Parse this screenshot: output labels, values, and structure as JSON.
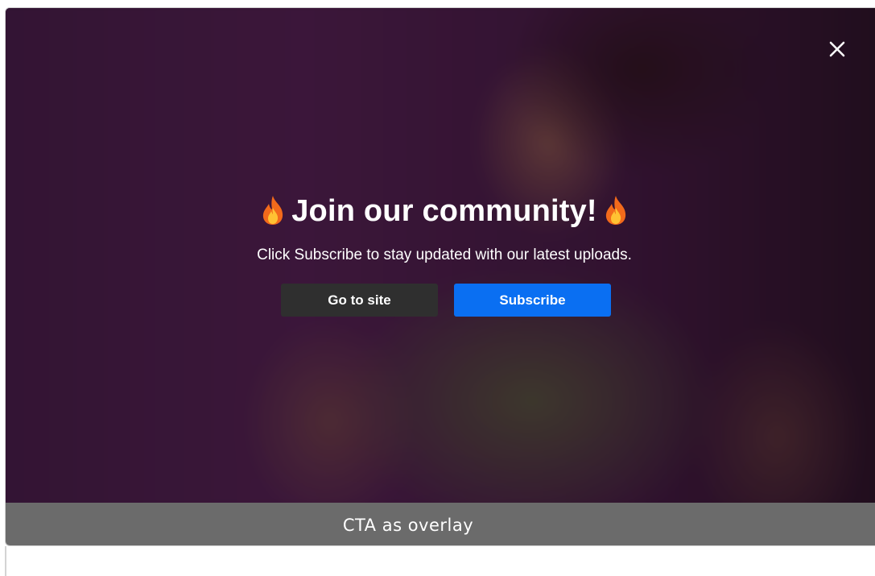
{
  "overlay": {
    "title": "Join our community!",
    "title_emoji": "🔥",
    "subtitle": "Click Subscribe to stay updated with our latest uploads.",
    "secondary_button_label": "Go to site",
    "primary_button_label": "Subscribe",
    "close_icon": "close-icon",
    "colors": {
      "primary_button": "#0a6ff2",
      "secondary_button": "#2f2f2f",
      "background": "#3a1738"
    }
  },
  "caption": {
    "text": "CTA as overlay",
    "background": "#6b6b6b"
  }
}
